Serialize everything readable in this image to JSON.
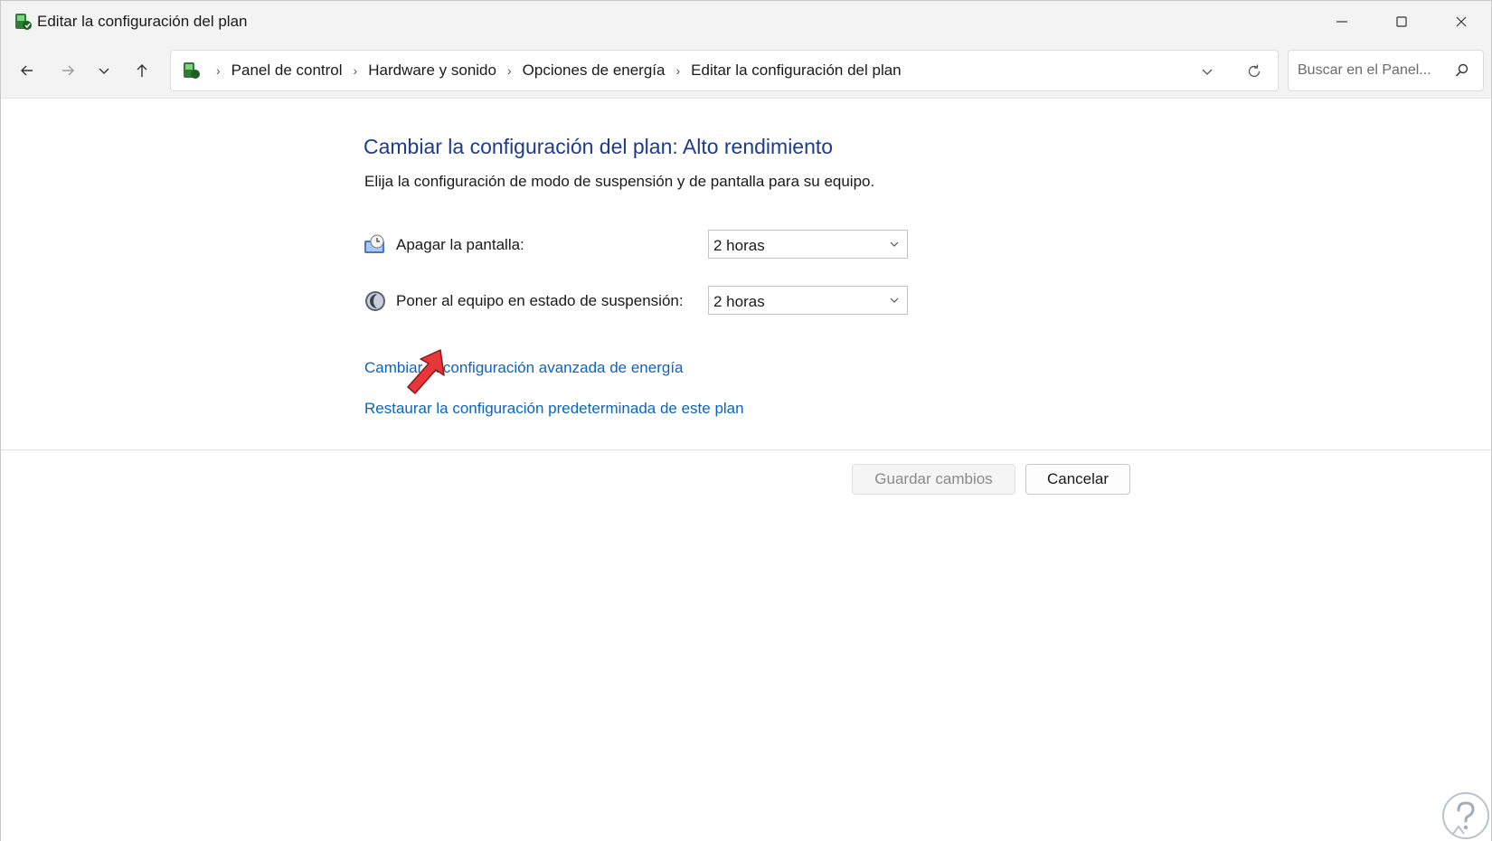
{
  "window": {
    "title": "Editar la configuración del plan"
  },
  "nav": {
    "back_icon": "arrow-left-icon",
    "forward_icon": "arrow-right-icon",
    "recent_icon": "chevron-down-icon",
    "up_icon": "arrow-up-icon"
  },
  "breadcrumb": {
    "items": [
      "Panel de control",
      "Hardware y sonido",
      "Opciones de energía",
      "Editar la configuración del plan"
    ]
  },
  "search": {
    "placeholder": "Buscar en el Panel..."
  },
  "main": {
    "heading": "Cambiar la configuración del plan: Alto rendimiento",
    "subtext": "Elija la configuración de modo de suspensión y de pantalla para su equipo.",
    "settings": [
      {
        "label": "Apagar la pantalla:",
        "value": "2 horas",
        "icon": "monitor-clock-icon"
      },
      {
        "label": "Poner al equipo en estado de suspensión:",
        "value": "2 horas",
        "icon": "moon-icon"
      }
    ],
    "links": {
      "advanced": "Cambiar la configuración avanzada de energía",
      "restore": "Restaurar la configuración predeterminada de este plan"
    },
    "buttons": {
      "save": "Guardar cambios",
      "cancel": "Cancelar"
    }
  },
  "colors": {
    "heading": "#1e3c8c",
    "link": "#0a64c8",
    "annotation_arrow": "#e8363a"
  }
}
